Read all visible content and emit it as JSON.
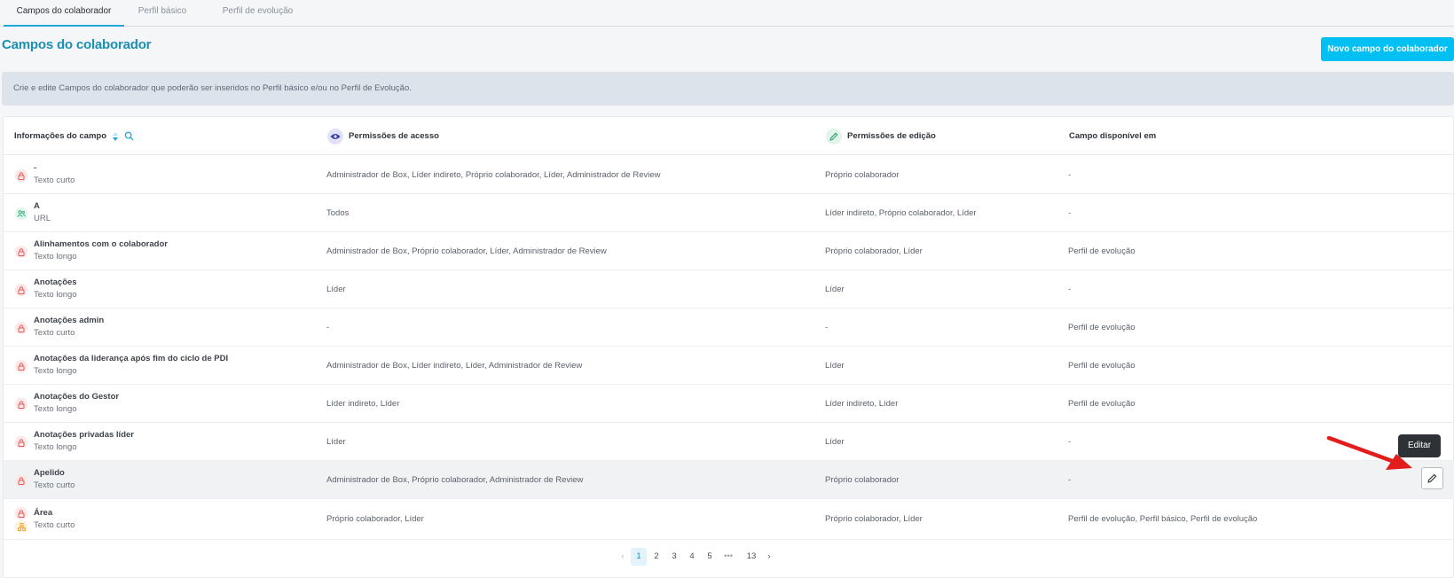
{
  "tabs": [
    {
      "label": "Campos do colaborador",
      "active": true
    },
    {
      "label": "Perfil básico",
      "active": false
    },
    {
      "label": "Perfil de evolução",
      "active": false
    }
  ],
  "page_title": "Campos do colaborador",
  "new_button_label": "Novo campo do colaborador",
  "info_text": "Crie e edite Campos do colaborador que poderão ser inseridos no Perfil básico e/ou no Perfil de Evolução.",
  "columns": {
    "info": "Informações do campo",
    "access": "Permissões de acesso",
    "edit": "Permissões de edição",
    "available": "Campo disponível em"
  },
  "rows": [
    {
      "name": "-",
      "type": "Texto curto",
      "icon": "lock-icon",
      "access": "Administrador de Box, Líder indireto, Próprio colaborador, Líder, Administrador de Review",
      "edit": "Próprio colaborador",
      "available": "-"
    },
    {
      "name": "A",
      "type": "URL",
      "icon": "people-icon",
      "access": "Todos",
      "edit": "Líder indireto, Próprio colaborador, Líder",
      "available": "-"
    },
    {
      "name": "Alinhamentos com o colaborador",
      "type": "Texto longo",
      "icon": "lock-icon",
      "access": "Administrador de Box, Próprio colaborador, Líder, Administrador de Review",
      "edit": "Próprio colaborador, Líder",
      "available": "Perfil de evolução"
    },
    {
      "name": "Anotações",
      "type": "Texto longo",
      "icon": "lock-icon",
      "access": "Líder",
      "edit": "Líder",
      "available": "-"
    },
    {
      "name": "Anotações admin",
      "type": "Texto curto",
      "icon": "lock-icon",
      "access": "-",
      "edit": "-",
      "available": "Perfil de evolução"
    },
    {
      "name": "Anotações da liderança após fim do ciclo de PDI",
      "type": "Texto longo",
      "icon": "lock-icon",
      "access": "Administrador de Box, Líder indireto, Líder, Administrador de Review",
      "edit": "Líder",
      "available": "Perfil de evolução"
    },
    {
      "name": "Anotações do Gestor",
      "type": "Texto longo",
      "icon": "lock-icon",
      "access": "Líder indireto, Líder",
      "edit": "Líder indireto, Líder",
      "available": "Perfil de evolução"
    },
    {
      "name": "Anotações privadas líder",
      "type": "Texto longo",
      "icon": "lock-icon",
      "access": "Líder",
      "edit": "Líder",
      "available": "-"
    },
    {
      "name": "Apelido",
      "type": "Texto curto",
      "icon": "lock-icon",
      "access": "Administrador de Box, Próprio colaborador, Administrador de Review",
      "edit": "Próprio colaborador",
      "available": "-"
    },
    {
      "name": "Área",
      "type": "Texto curto",
      "icon": "lock-icon",
      "icon2": "org-icon",
      "access": "Próprio colaborador, Líder",
      "edit": "Próprio colaborador, Líder",
      "available": "Perfil de evolução, Perfil básico, Perfil de evolução"
    }
  ],
  "tooltip_label": "Editar",
  "pagination": {
    "pages": [
      "1",
      "2",
      "3",
      "4",
      "5"
    ],
    "ellipsis": "•••",
    "last": "13",
    "current": "1"
  },
  "colors": {
    "accent": "#00bff3",
    "title": "#1c8fb3",
    "lock": "#e05a5a",
    "people": "#2fb37a",
    "org": "#f0a030",
    "arrow": "#e31c1c"
  }
}
